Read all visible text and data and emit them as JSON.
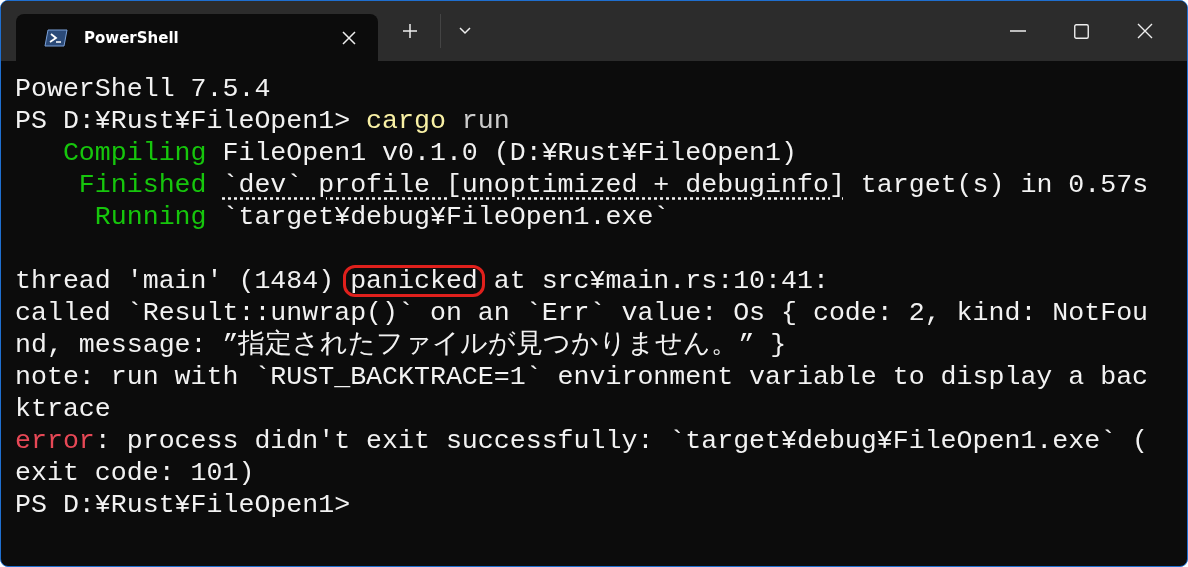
{
  "window": {
    "tab_title": "PowerShell"
  },
  "terminal": {
    "lines": [
      {
        "segments": [
          {
            "text": "PowerShell 7.5.4",
            "kind": "plain"
          }
        ]
      },
      {
        "segments": [
          {
            "text": "PS D:¥Rust¥FileOpen1> ",
            "kind": "plain"
          },
          {
            "text": "cargo",
            "kind": "command"
          },
          {
            "text": " run",
            "kind": "argument"
          }
        ]
      },
      {
        "segments": [
          {
            "text": "   Compiling",
            "kind": "success"
          },
          {
            "text": " FileOpen1 v0.1.0 (D:¥Rust¥FileOpen1)",
            "kind": "plain"
          }
        ]
      },
      {
        "segments": [
          {
            "text": "    Finished ",
            "kind": "success"
          },
          {
            "text": "`dev` profile [unoptimized + debuginfo]",
            "kind": "link"
          },
          {
            "text": " target(s) in 0.57s",
            "kind": "plain"
          }
        ]
      },
      {
        "segments": [
          {
            "text": "     Running",
            "kind": "success"
          },
          {
            "text": " `target¥debug¥FileOpen1.exe`",
            "kind": "plain"
          }
        ]
      },
      {
        "blank_before": true,
        "segments": [
          {
            "text": "thread 'main' (1484) ",
            "kind": "plain"
          },
          {
            "text": "panicked",
            "kind": "circled"
          },
          {
            "text": " at src¥main.rs:10:41:",
            "kind": "plain"
          }
        ]
      },
      {
        "segments": [
          {
            "text": "called `Result::unwrap()` on an `Err` value: Os { code: 2, kind: NotFou",
            "kind": "plain"
          }
        ]
      },
      {
        "segments": [
          {
            "text": "nd, message: ”指定されたファイルが見つかりません。” }",
            "kind": "plain"
          }
        ]
      },
      {
        "segments": [
          {
            "text": "note: run with `RUST_BACKTRACE=1` environment variable to display a bac",
            "kind": "plain"
          }
        ]
      },
      {
        "segments": [
          {
            "text": "ktrace",
            "kind": "plain"
          }
        ]
      },
      {
        "segments": [
          {
            "text": "error",
            "kind": "error"
          },
          {
            "text": ": process didn't exit successfully: `target¥debug¥FileOpen1.exe` (",
            "kind": "plain"
          }
        ]
      },
      {
        "segments": [
          {
            "text": "exit code: 101)",
            "kind": "plain"
          }
        ]
      },
      {
        "segments": [
          {
            "text": "PS D:¥Rust¥FileOpen1>",
            "kind": "plain"
          }
        ]
      }
    ]
  }
}
